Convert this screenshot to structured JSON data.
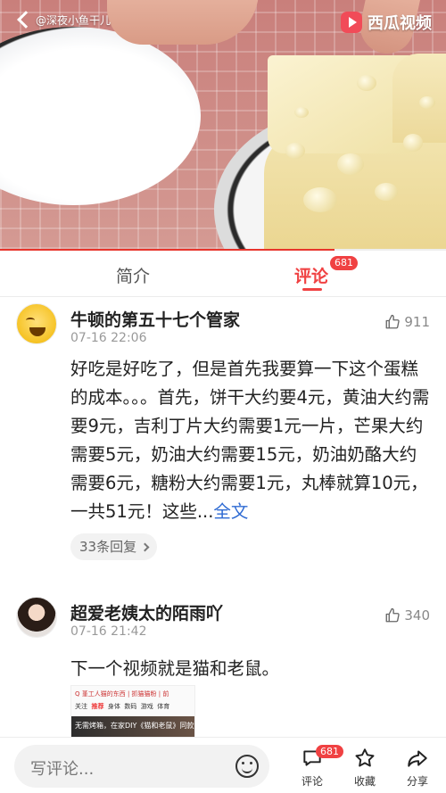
{
  "video": {
    "channel": "@深夜小鱼干儿",
    "brand": "西瓜视频",
    "progress_fraction": 0.75
  },
  "tabs": [
    {
      "label": "简介",
      "active": false
    },
    {
      "label": "评论",
      "active": true,
      "badge": "681"
    }
  ],
  "comments": [
    {
      "name": "牛顿的第五十七个管家",
      "time": "07-16 22:06",
      "likes": "911",
      "text": "好吃是好吃了，但是首先我要算一下这个蛋糕的成本。。。首先，饼干大约要4元，黄油大约需要9元，吉利丁片大约需要1元一片，芒果大约需要5元，奶油大约需要15元，奶油奶酪大约需要6元，糖粉大约需要1元，丸棒就算10元，一共51元！这些...",
      "more": "全文",
      "replies": "33条回复"
    },
    {
      "name": "超爱老姨太的陌雨吖",
      "time": "07-16 21:42",
      "likes": "340",
      "text": "下一个视频就是猫和老鼠。",
      "screenshot": {
        "top": "Q 堇工人猫的东西 | 抓猫猫粉 | 前",
        "tabs": [
          "关注",
          "推荐",
          "身体",
          "数码",
          "游戏",
          "体育"
        ],
        "caption": "无需烤箱，在家DIY《猫和老鼠》同款奶酪蛋糕"
      }
    }
  ],
  "bottom_bar": {
    "placeholder": "写评论...",
    "comment_label": "评论",
    "comment_badge": "681",
    "favorite_label": "收藏",
    "share_label": "分享"
  },
  "colors": {
    "accent": "#f04142",
    "link": "#2f6bd3"
  },
  "icons": [
    "back-icon",
    "xigua-logo-icon",
    "thumbs-up-icon",
    "chevron-right-icon",
    "emoji-icon",
    "comment-icon",
    "star-icon",
    "share-icon"
  ]
}
